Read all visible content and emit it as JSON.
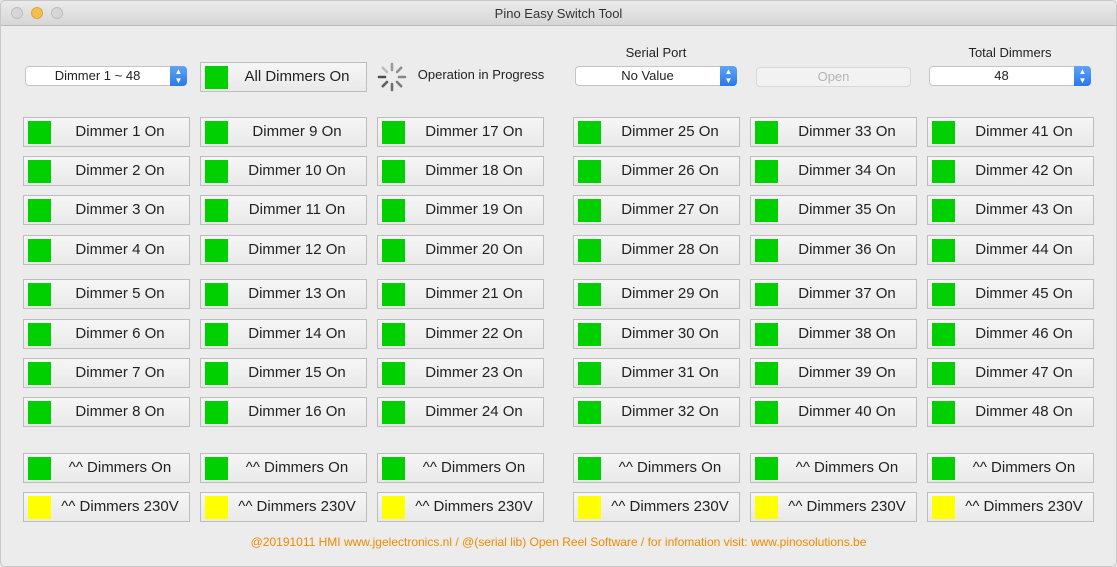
{
  "window": {
    "title": "Pino Easy Switch Tool"
  },
  "top": {
    "dimmer_select": "Dimmer 1 ~ 48",
    "all_dimmers_label": "All Dimmers On",
    "progress_label": "Operation in Progress",
    "serial_port_label": "Serial Port",
    "serial_port_value": "No Value",
    "open_label": "Open",
    "total_dimmers_label": "Total Dimmers",
    "total_dimmers_value": "48"
  },
  "dimmers": [
    "Dimmer 1 On",
    "Dimmer 2 On",
    "Dimmer 3 On",
    "Dimmer 4 On",
    "Dimmer 5 On",
    "Dimmer 6 On",
    "Dimmer 7 On",
    "Dimmer 8 On",
    "Dimmer 9 On",
    "Dimmer 10 On",
    "Dimmer 11 On",
    "Dimmer 12 On",
    "Dimmer 13 On",
    "Dimmer 14 On",
    "Dimmer 15 On",
    "Dimmer 16 On",
    "Dimmer 17 On",
    "Dimmer 18 On",
    "Dimmer 19 On",
    "Dimmer 20 On",
    "Dimmer 21 On",
    "Dimmer 22 On",
    "Dimmer 23 On",
    "Dimmer 24 On",
    "Dimmer 25 On",
    "Dimmer 26 On",
    "Dimmer 27 On",
    "Dimmer 28 On",
    "Dimmer 29 On",
    "Dimmer 30 On",
    "Dimmer 31 On",
    "Dimmer 32 On",
    "Dimmer 33 On",
    "Dimmer 34 On",
    "Dimmer 35 On",
    "Dimmer 36 On",
    "Dimmer 37 On",
    "Dimmer 38 On",
    "Dimmer 39 On",
    "Dimmer 40 On",
    "Dimmer 41 On",
    "Dimmer 42 On",
    "Dimmer 43 On",
    "Dimmer 44 On",
    "Dimmer 45 On",
    "Dimmer 46 On",
    "Dimmer 47 On",
    "Dimmer 48 On"
  ],
  "group_on": [
    "^^ Dimmers On",
    "^^ Dimmers On",
    "^^ Dimmers On",
    "^^ Dimmers On",
    "^^ Dimmers On",
    "^^ Dimmers On"
  ],
  "group_230v": [
    "^^ Dimmers 230V",
    "^^ Dimmers 230V",
    "^^ Dimmers 230V",
    "^^ Dimmers 230V",
    "^^ Dimmers 230V",
    "^^ Dimmers 230V"
  ],
  "footer": "@20191011 HMI www.jgelectronics.nl   /  @(serial lib) Open Reel Software  /  for infomation visit:  www.pinosolutions.be",
  "colors": {
    "led_on": "#00d000",
    "led_230v": "#ffff00",
    "footer": "#f08a00",
    "accent": "#2a78ea"
  },
  "icons": {
    "spinner": "progress-spinner-icon",
    "chevron": "chevron-updown-icon"
  }
}
